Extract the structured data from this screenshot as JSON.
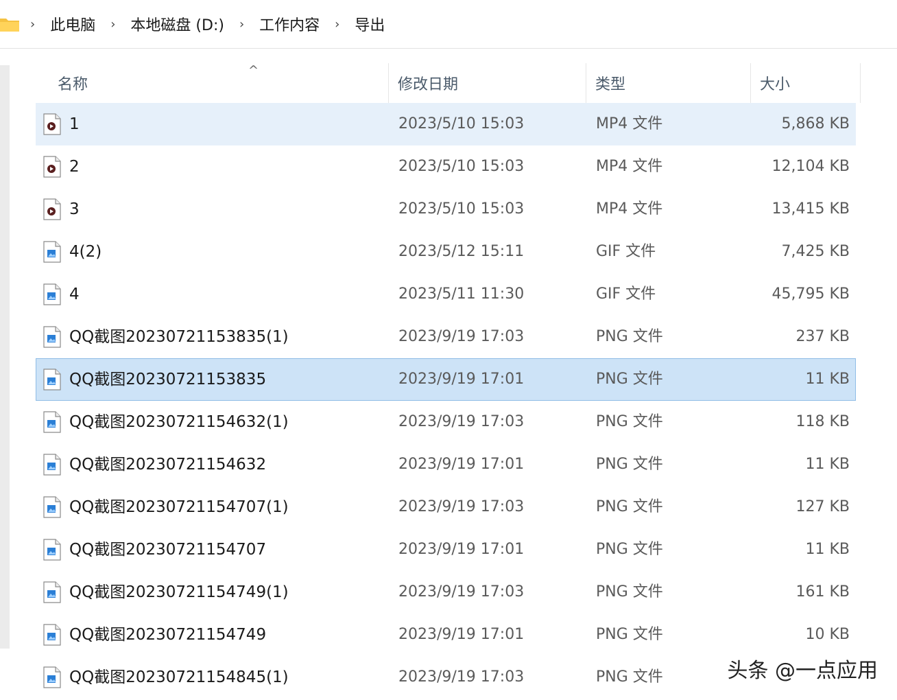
{
  "breadcrumb": [
    "此电脑",
    "本地磁盘 (D:)",
    "工作内容",
    "导出"
  ],
  "columns": {
    "name": "名称",
    "date": "修改日期",
    "type": "类型",
    "size": "大小"
  },
  "sort_indicator": "^",
  "files": [
    {
      "name": "1",
      "date": "2023/5/10 15:03",
      "type": "MP4 文件",
      "size": "5,868 KB",
      "icon": "video-file-icon",
      "selected": true,
      "focused": false
    },
    {
      "name": "2",
      "date": "2023/5/10 15:03",
      "type": "MP4 文件",
      "size": "12,104 KB",
      "icon": "video-file-icon",
      "selected": false,
      "focused": false
    },
    {
      "name": "3",
      "date": "2023/5/10 15:03",
      "type": "MP4 文件",
      "size": "13,415 KB",
      "icon": "video-file-icon",
      "selected": false,
      "focused": false
    },
    {
      "name": "4(2)",
      "date": "2023/5/12 15:11",
      "type": "GIF 文件",
      "size": "7,425 KB",
      "icon": "image-file-icon",
      "selected": false,
      "focused": false
    },
    {
      "name": "4",
      "date": "2023/5/11 11:30",
      "type": "GIF 文件",
      "size": "45,795 KB",
      "icon": "image-file-icon",
      "selected": false,
      "focused": false
    },
    {
      "name": "QQ截图20230721153835(1)",
      "date": "2023/9/19 17:03",
      "type": "PNG 文件",
      "size": "237 KB",
      "icon": "image-file-icon",
      "selected": false,
      "focused": false
    },
    {
      "name": "QQ截图20230721153835",
      "date": "2023/9/19 17:01",
      "type": "PNG 文件",
      "size": "11 KB",
      "icon": "image-file-icon",
      "selected": true,
      "focused": true
    },
    {
      "name": "QQ截图20230721154632(1)",
      "date": "2023/9/19 17:03",
      "type": "PNG 文件",
      "size": "118 KB",
      "icon": "image-file-icon",
      "selected": false,
      "focused": false
    },
    {
      "name": "QQ截图20230721154632",
      "date": "2023/9/19 17:01",
      "type": "PNG 文件",
      "size": "11 KB",
      "icon": "image-file-icon",
      "selected": false,
      "focused": false
    },
    {
      "name": "QQ截图20230721154707(1)",
      "date": "2023/9/19 17:03",
      "type": "PNG 文件",
      "size": "127 KB",
      "icon": "image-file-icon",
      "selected": false,
      "focused": false
    },
    {
      "name": "QQ截图20230721154707",
      "date": "2023/9/19 17:01",
      "type": "PNG 文件",
      "size": "11 KB",
      "icon": "image-file-icon",
      "selected": false,
      "focused": false
    },
    {
      "name": "QQ截图20230721154749(1)",
      "date": "2023/9/19 17:03",
      "type": "PNG 文件",
      "size": "161 KB",
      "icon": "image-file-icon",
      "selected": false,
      "focused": false
    },
    {
      "name": "QQ截图20230721154749",
      "date": "2023/9/19 17:01",
      "type": "PNG 文件",
      "size": "10 KB",
      "icon": "image-file-icon",
      "selected": false,
      "focused": false
    },
    {
      "name": "QQ截图20230721154845(1)",
      "date": "2023/9/19 17:03",
      "type": "PNG 文件",
      "size": "",
      "icon": "image-file-icon",
      "selected": false,
      "focused": false
    }
  ],
  "watermark": "头条 @一点应用",
  "colors": {
    "selection": "#cde3f7",
    "selection_border": "#8fbce6",
    "hover": "#e6f0fa",
    "folder": "#f5c242"
  }
}
